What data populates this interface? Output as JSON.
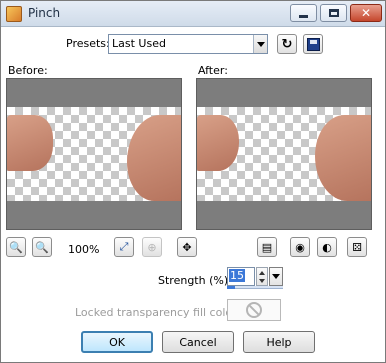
{
  "window": {
    "title": "Pinch",
    "controls": [
      "minimize",
      "maximize",
      "close"
    ]
  },
  "presets": {
    "label": "Presets:",
    "value": "Last Used"
  },
  "preview": {
    "before_label": "Before:",
    "after_label": "After:"
  },
  "zoom": {
    "level": "100%"
  },
  "strength": {
    "label": "Strength (%):",
    "value": "15"
  },
  "fill": {
    "label": "Locked transparency fill color:"
  },
  "buttons": {
    "ok": "OK",
    "cancel": "Cancel",
    "help": "Help"
  },
  "colors": {
    "titlebar": "#dbe5f1",
    "accent": "#3c78d8",
    "preview_frame": "#7d7d7d",
    "skin": "#c98a72"
  },
  "icons": [
    "app-icon",
    "reset-icon",
    "save-preset-icon",
    "zoom-out-icon",
    "zoom-in-icon",
    "zoom-to-fit-icon",
    "actual-size-icon",
    "pan-icon",
    "proof-icon",
    "randomize-icon",
    "preview-on-image-icon",
    "reset-default-icon",
    "dropdown-arrow-icon",
    "no-color-icon"
  ]
}
